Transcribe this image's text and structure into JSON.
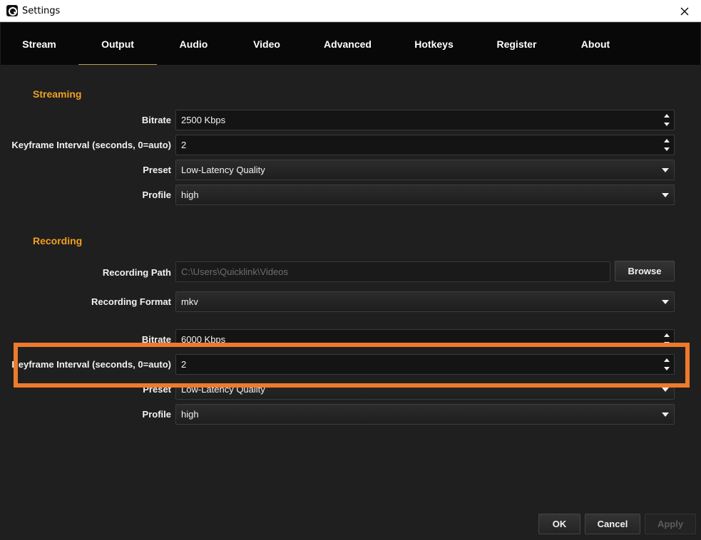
{
  "window": {
    "title": "Settings"
  },
  "tabs": [
    {
      "label": "Stream"
    },
    {
      "label": "Output"
    },
    {
      "label": "Audio"
    },
    {
      "label": "Video"
    },
    {
      "label": "Advanced"
    },
    {
      "label": "Hotkeys"
    },
    {
      "label": "Register"
    },
    {
      "label": "About"
    }
  ],
  "active_tab": "Output",
  "streaming": {
    "title": "Streaming",
    "bitrate_label": "Bitrate",
    "bitrate_value": "2500 Kbps",
    "keyframe_label": "Keyframe Interval (seconds, 0=auto)",
    "keyframe_value": "2",
    "preset_label": "Preset",
    "preset_value": "Low-Latency Quality",
    "profile_label": "Profile",
    "profile_value": "high"
  },
  "recording": {
    "title": "Recording",
    "path_label": "Recording Path",
    "path_value": "C:\\Users\\Quicklink\\Videos",
    "browse_label": "Browse",
    "format_label": "Recording Format",
    "format_value": "mkv",
    "bitrate_label": "Bitrate",
    "bitrate_value": "6000 Kbps",
    "keyframe_label": "Keyframe Interval (seconds, 0=auto)",
    "keyframe_value": "2",
    "preset_label": "Preset",
    "preset_value": "Low-Latency Quality",
    "profile_label": "Profile",
    "profile_value": "high"
  },
  "footer": {
    "ok_label": "OK",
    "cancel_label": "Cancel",
    "apply_label": "Apply"
  },
  "colors": {
    "accent_orange": "#f0a020",
    "highlight_box": "#ee7a2c",
    "background": "#1f1f1f",
    "tabbar": "#080808"
  }
}
